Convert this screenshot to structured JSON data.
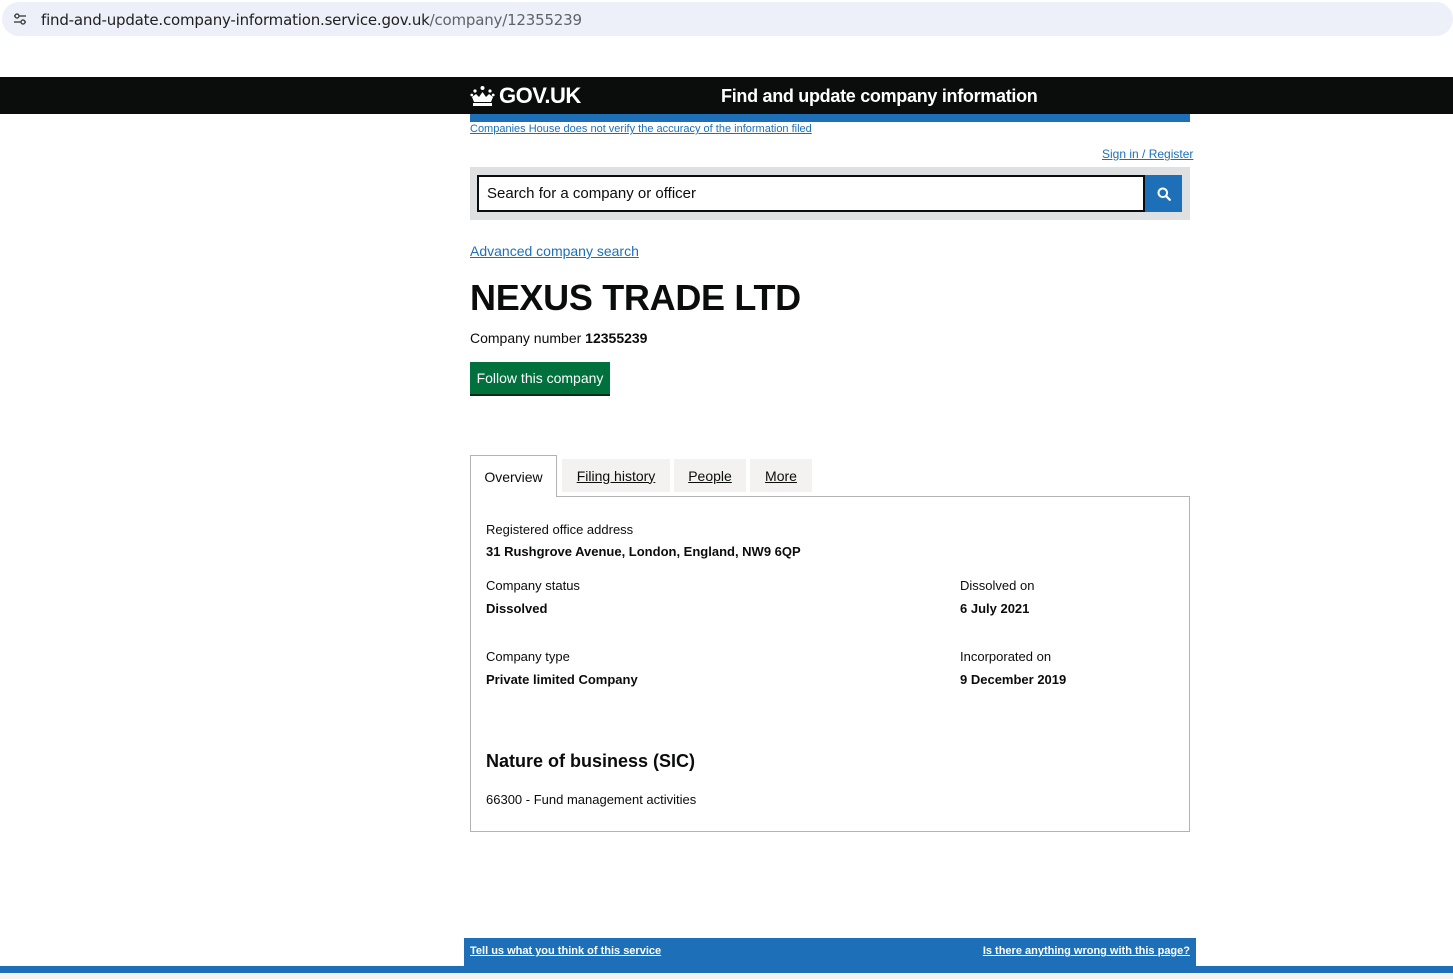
{
  "browser": {
    "url_host": "find-and-update.company-information.service.gov.uk",
    "url_path": "/company/12355239"
  },
  "header": {
    "logo_text": "GOV.UK",
    "service_name": "Find and update company information",
    "disclaimer": "Companies House does not verify the accuracy of the information filed",
    "signin": "Sign in / Register"
  },
  "search": {
    "placeholder": "Search for a company or officer",
    "value": ""
  },
  "advanced_search_link": "Advanced company search",
  "company": {
    "name": "NEXUS TRADE LTD",
    "number_label": "Company number",
    "number": "12355239",
    "follow_label": "Follow this company"
  },
  "tabs": [
    {
      "label": "Overview",
      "active": true
    },
    {
      "label": "Filing history",
      "active": false
    },
    {
      "label": "People",
      "active": false
    },
    {
      "label": "More",
      "active": false
    }
  ],
  "overview": {
    "address_label": "Registered office address",
    "address_value": "31 Rushgrove Avenue, London, England, NW9 6QP",
    "status_label": "Company status",
    "status_value": "Dissolved",
    "dissolved_label": "Dissolved on",
    "dissolved_value": "6 July 2021",
    "type_label": "Company type",
    "type_value": "Private limited Company",
    "incorporated_label": "Incorporated on",
    "incorporated_value": "9 December 2019",
    "sic_heading": "Nature of business (SIC)",
    "sic_items": [
      "66300 - Fund management activities"
    ]
  },
  "footer": {
    "feedback_link": "Tell us what you think of this service",
    "report_link": "Is there anything wrong with this page?"
  },
  "colors": {
    "header_bg": "#0b0c0c",
    "link_blue": "#1d70b8",
    "follow_green": "#00703c"
  }
}
